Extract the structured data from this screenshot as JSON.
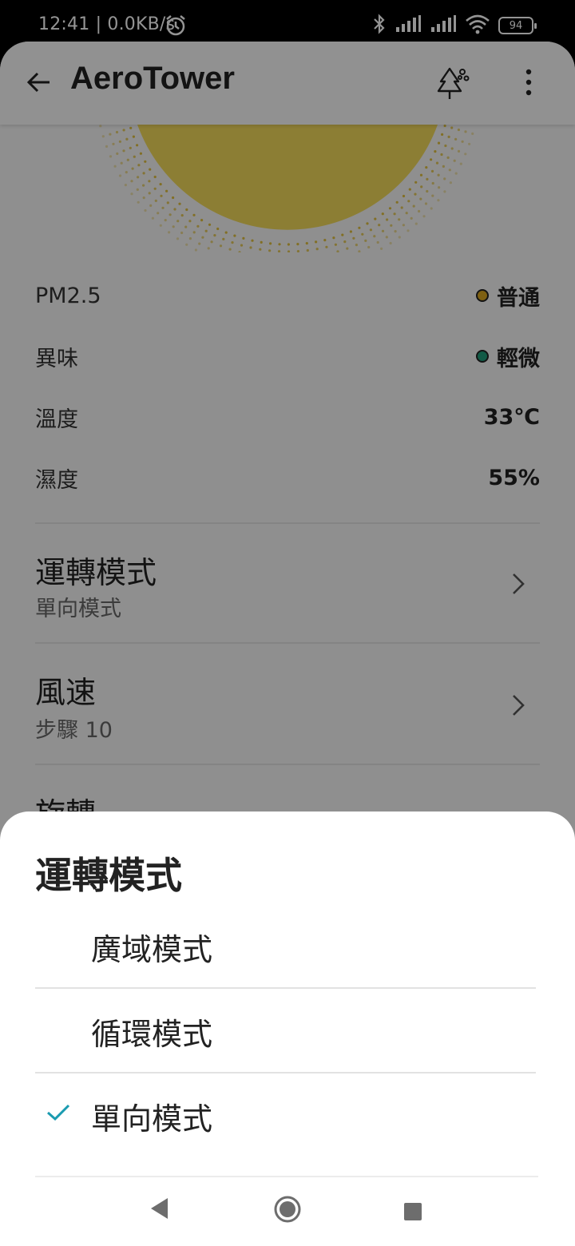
{
  "status_bar": {
    "time": "12:41 | 0.0KB/s",
    "battery": "94",
    "icons": [
      "alarm-icon",
      "bluetooth-icon",
      "signal-icon",
      "signal-icon",
      "wifi-icon",
      "battery-icon"
    ]
  },
  "header": {
    "title": "AeroTower",
    "icons": [
      "back-arrow-icon",
      "tree-icon",
      "more-vertical-icon"
    ]
  },
  "metrics": [
    {
      "label": "PM2.5",
      "value": "普通",
      "dot_color": "#d9a520"
    },
    {
      "label": "異味",
      "value": "輕微",
      "dot_color": "#1f9b79"
    },
    {
      "label": "溫度",
      "value": "33℃"
    },
    {
      "label": "濕度",
      "value": "55%"
    }
  ],
  "settings": [
    {
      "title": "運轉模式",
      "subtitle": "單向模式"
    },
    {
      "title": "風速",
      "subtitle": "步驟 10"
    },
    {
      "title": "旋轉"
    }
  ],
  "sheet": {
    "title": "運轉模式",
    "options": [
      {
        "label": "廣域模式",
        "selected": false
      },
      {
        "label": "循環模式",
        "selected": false
      },
      {
        "label": "單向模式",
        "selected": true
      }
    ],
    "check_color": "#1a9bb0"
  },
  "nav_bar": {
    "icons": [
      "nav-back-icon",
      "nav-home-icon",
      "nav-recents-icon"
    ]
  },
  "colors": {
    "hero_fill": "#f2d64a",
    "scrim": "rgba(0,0,0,0.42)"
  }
}
